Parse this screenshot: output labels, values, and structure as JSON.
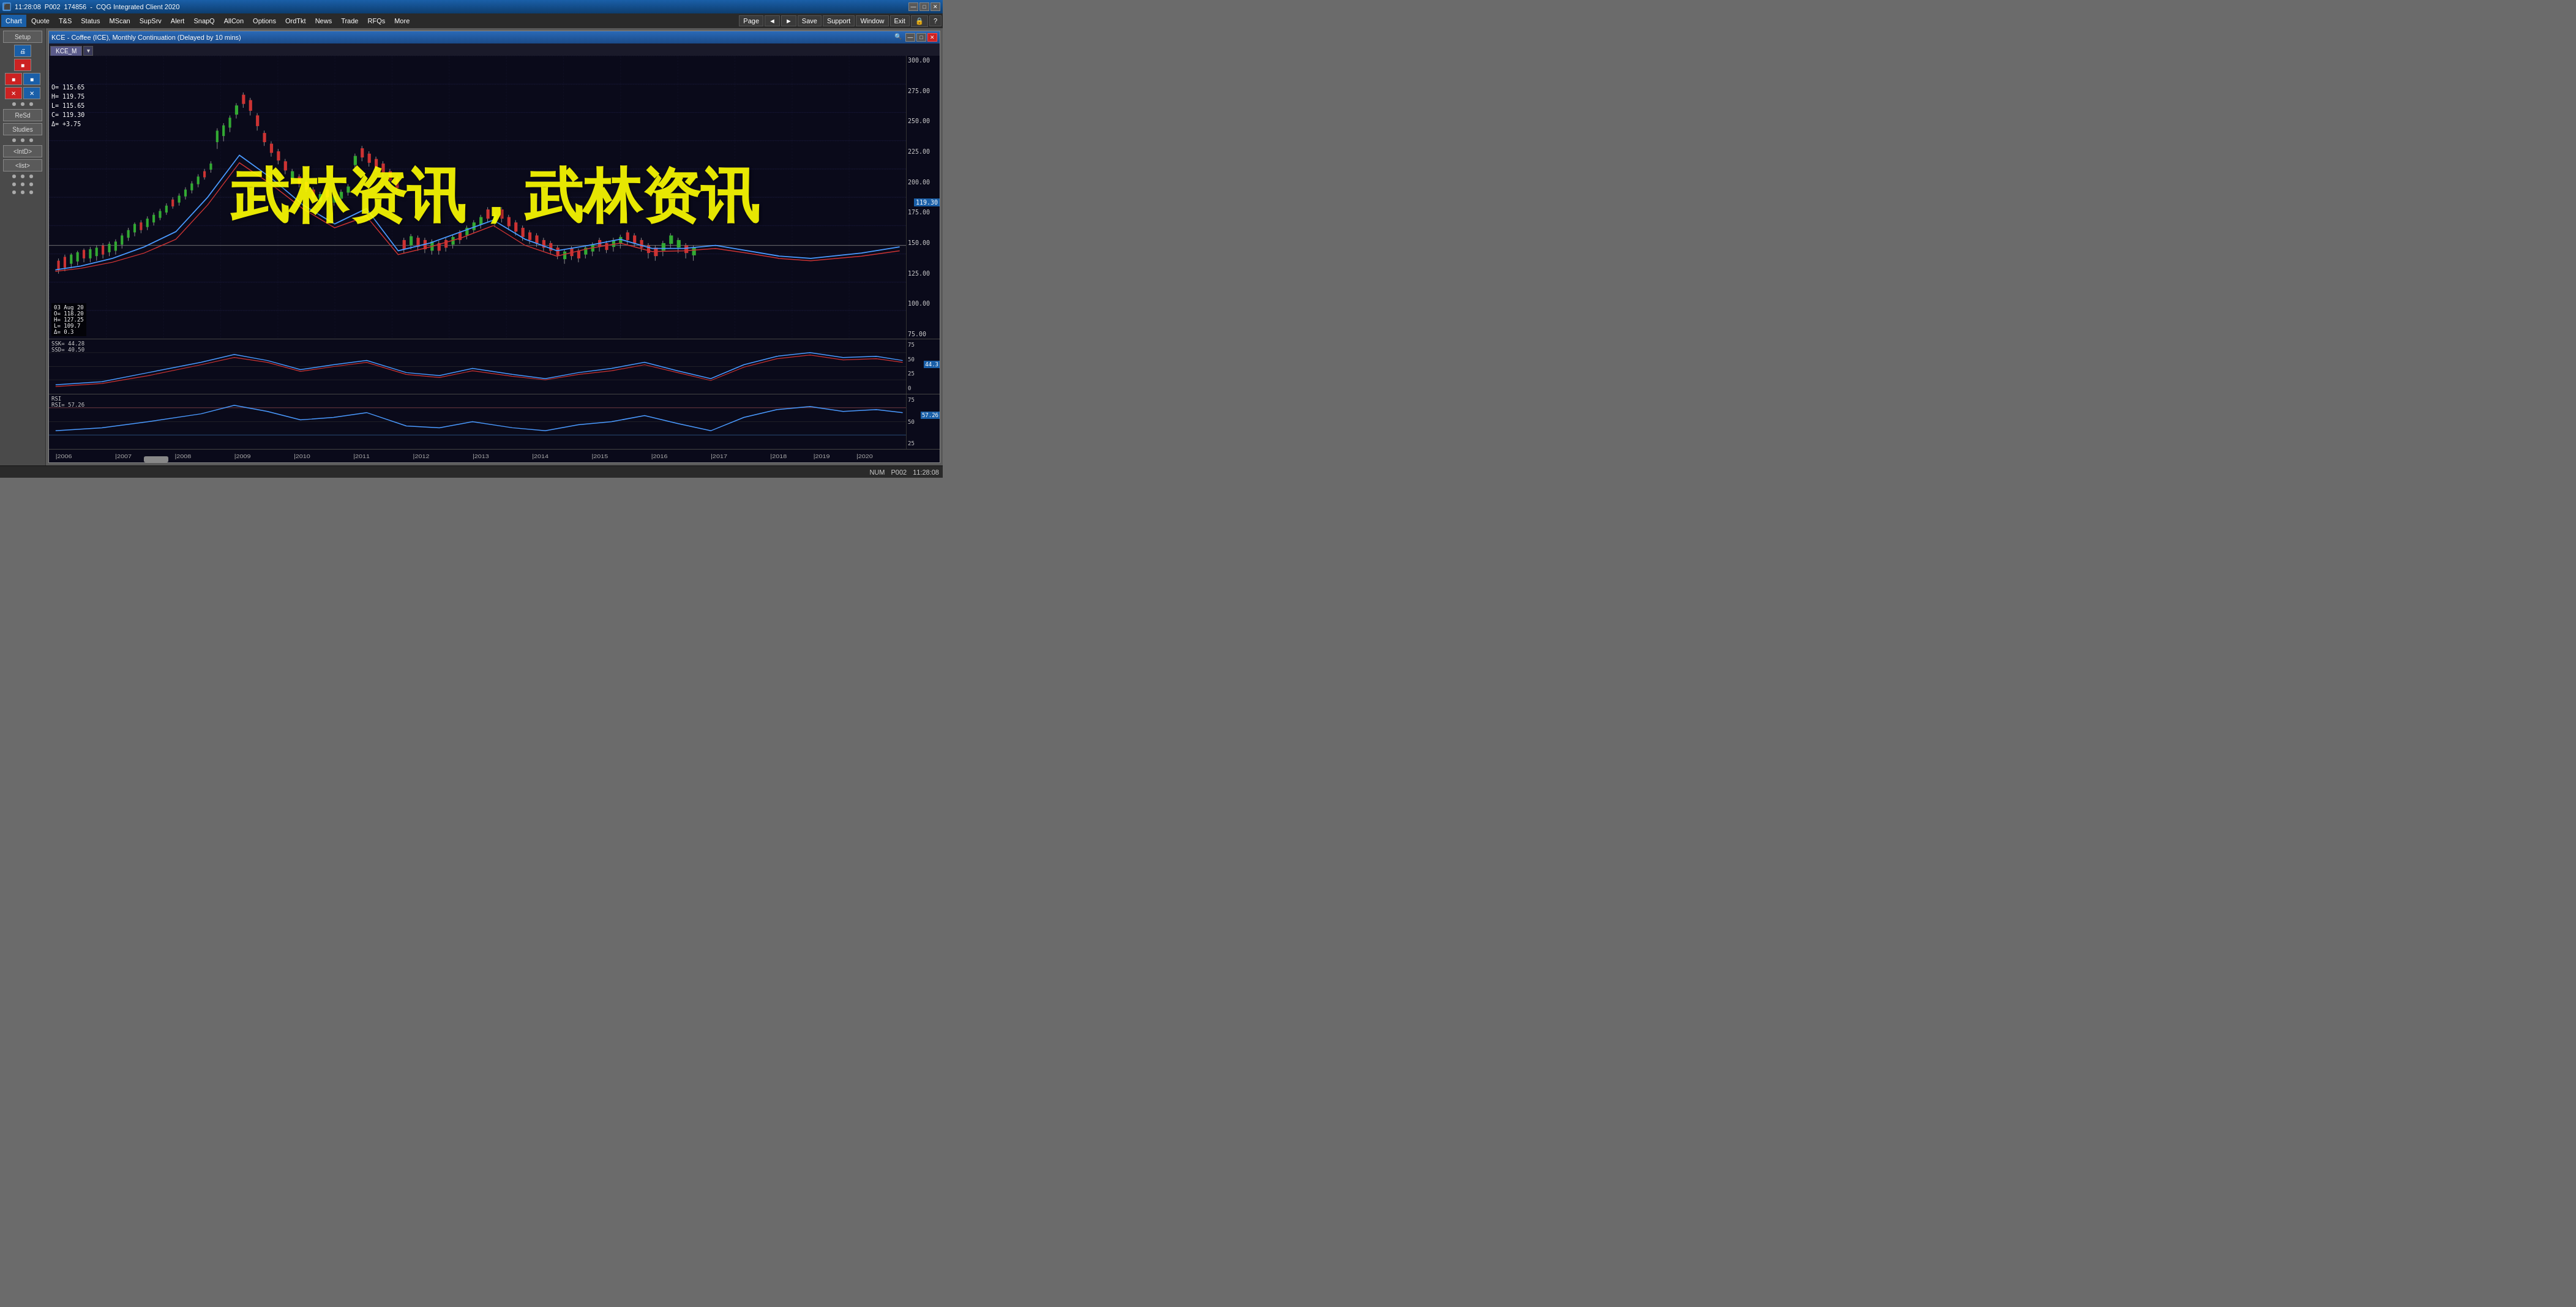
{
  "titleBar": {
    "time": "11:28:08",
    "appId": "P002",
    "windowId": "174856",
    "title": "CQG Integrated Client 2020",
    "minimizeBtn": "—",
    "maximizeBtn": "□",
    "closeBtn": "✕"
  },
  "menuBar": {
    "items": [
      {
        "label": "Chart",
        "active": true
      },
      {
        "label": "Quote",
        "active": false
      },
      {
        "label": "T&S",
        "active": false
      },
      {
        "label": "Status",
        "active": false
      },
      {
        "label": "MScan",
        "active": false
      },
      {
        "label": "SupSrv",
        "active": false
      },
      {
        "label": "Alert",
        "active": false
      },
      {
        "label": "SnapQ",
        "active": false
      },
      {
        "label": "AllCon",
        "active": false
      },
      {
        "label": "Options",
        "active": false
      },
      {
        "label": "OrdTkt",
        "active": false
      },
      {
        "label": "News",
        "active": false
      },
      {
        "label": "Trade",
        "active": false
      },
      {
        "label": "RFQs",
        "active": false
      },
      {
        "label": "More",
        "active": false
      }
    ],
    "rightItems": [
      {
        "label": "Page"
      },
      {
        "label": "◄"
      },
      {
        "label": "►"
      },
      {
        "label": "Save"
      },
      {
        "label": "Support"
      },
      {
        "label": "Window"
      },
      {
        "label": "Exit"
      },
      {
        "label": "🔒"
      },
      {
        "label": "?"
      }
    ]
  },
  "sidebar": {
    "setupLabel": "Setup",
    "buttons": [
      {
        "label": "ReSd"
      },
      {
        "label": "Studies"
      },
      {
        "label": "<IntD>"
      },
      {
        "label": "<list>"
      }
    ]
  },
  "chart": {
    "title": "KCE - Coffee (ICE), Monthly Continuation (Delayed by 10 mins)",
    "tabLabel": "KCE_M",
    "ohlc": {
      "open": "O=  115.65",
      "high": "H=  119.75",
      "low": "L=  115.65",
      "close": "C=  119.30",
      "delta": "Δ=  +3.75"
    },
    "currentPrice": "119.30",
    "priceScale": [
      "300.00",
      "275.00",
      "250.00",
      "225.00",
      "200.00",
      "175.00",
      "150.00",
      "125.00",
      "100.00",
      "75.00"
    ],
    "watermark": "武林资讯，武林资讯",
    "stoch": {
      "ssk": "44.28",
      "ssd": "40.50",
      "scale": [
        "75",
        "50",
        "25",
        "0"
      ],
      "currentValue": "44.3"
    },
    "rsi": {
      "value": "57.26",
      "label": "RSI",
      "scale": [
        "75",
        "50",
        "25"
      ],
      "currentValue": "57.26"
    },
    "timeAxis": [
      "2006",
      "2007",
      "2008",
      "2009",
      "2010",
      "2011",
      "2012",
      "2013",
      "2014",
      "2015",
      "2016",
      "2017",
      "2018",
      "2019",
      "2020"
    ],
    "hoverTooltip": {
      "date": "03 Aug 20",
      "open": "O=  118.20",
      "high": "H=  127.25",
      "low": "L=  109.7",
      "delta": "Δ=  0.3"
    }
  },
  "statusBar": {
    "numLock": "NUM",
    "pageId": "P002",
    "time": "11:28:08"
  }
}
